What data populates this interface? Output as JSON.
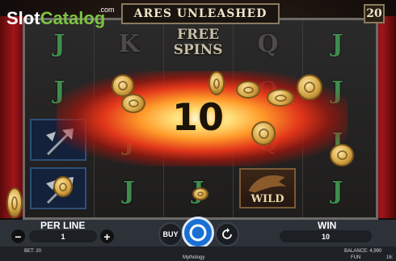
{
  "logo": {
    "slot": "Slot",
    "catalog": "Catalog",
    "com": ".com"
  },
  "header": {
    "title": "ARES UNLEASHED",
    "lines": "20"
  },
  "reels": {
    "free_spins_line1": "FREE",
    "free_spins_line2": "SPINS",
    "wild_label": "WILD",
    "letters": {
      "j": "J",
      "k": "K",
      "q": "Q"
    }
  },
  "win_popup": {
    "amount": "10"
  },
  "controls": {
    "per_line_label": "PER LINE",
    "per_line_value": "1",
    "minus": "−",
    "plus": "+",
    "buy_label": "BUY",
    "win_label": "WIN",
    "win_value": "10"
  },
  "info_bar": {
    "bet": "BET: 20",
    "game_provider": "Mythology",
    "balance": "BALANCE: 4,990",
    "mode": "FUN",
    "clock": "16:"
  },
  "colors": {
    "accent_blue": "#1a6fd4",
    "bar_bg": "#2d3138",
    "letter_green": "#3f8c4e",
    "logo_green": "#7cc242"
  }
}
